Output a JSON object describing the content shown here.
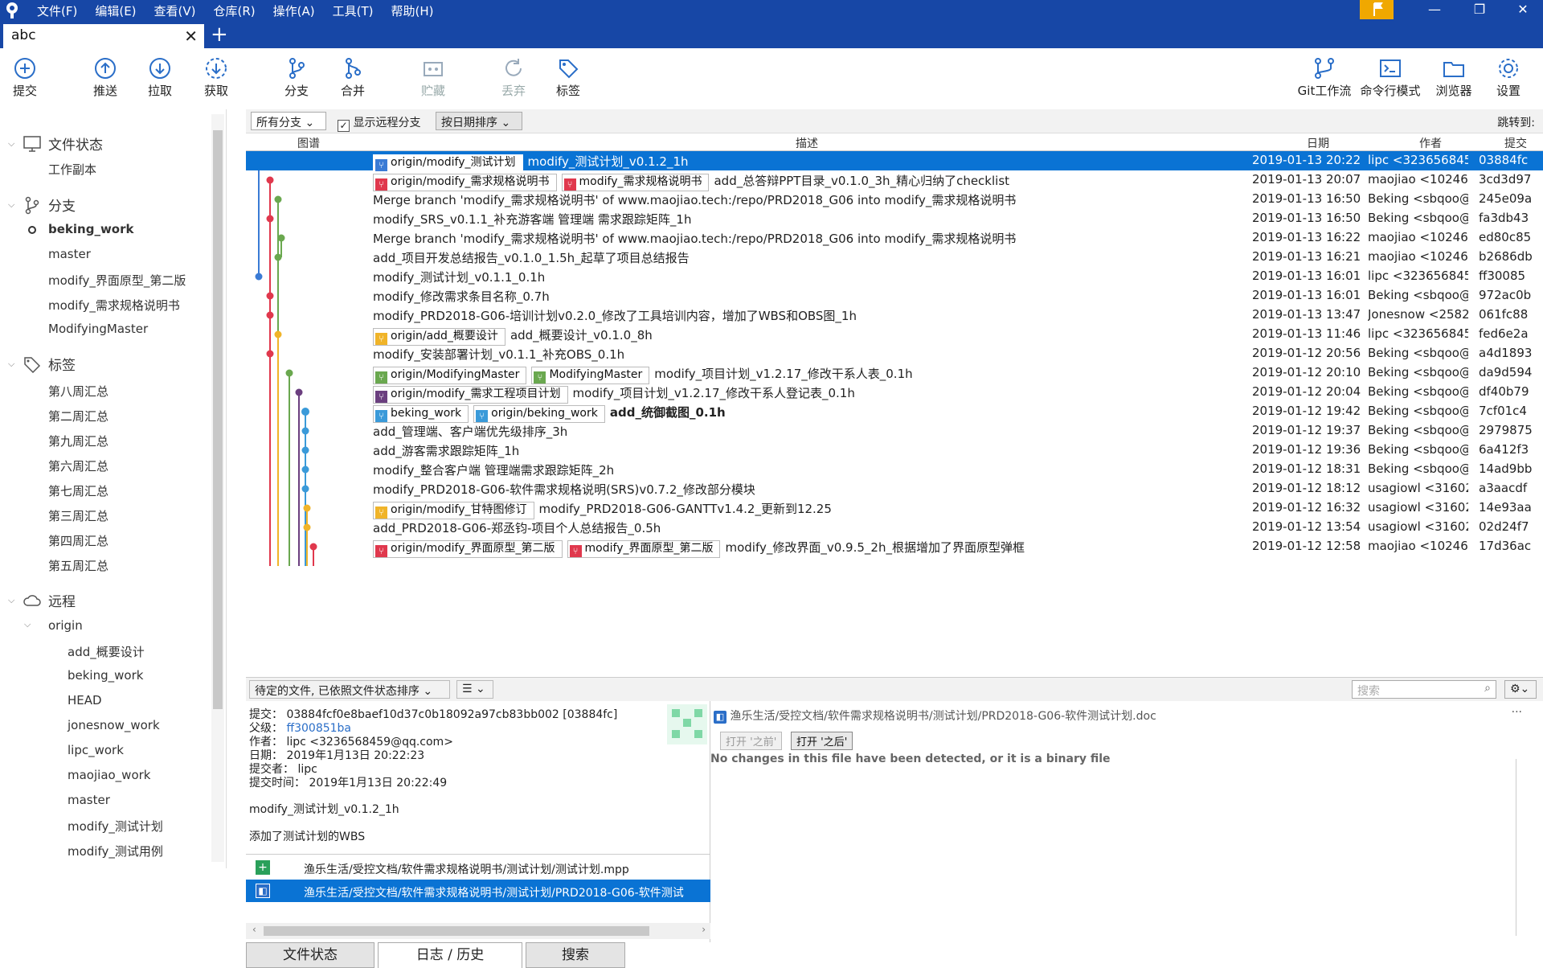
{
  "menu": [
    "文件(F)",
    "编辑(E)",
    "查看(V)",
    "仓库(R)",
    "操作(A)",
    "工具(T)",
    "帮助(H)"
  ],
  "window": {
    "minimize": "—",
    "restore": "❐",
    "close": "✕"
  },
  "tab": {
    "title": "abc",
    "close": "✕",
    "new": "+"
  },
  "toolbar": {
    "commit": "提交",
    "push": "推送",
    "pull": "拉取",
    "fetch": "获取",
    "branch": "分支",
    "merge": "合并",
    "stash": "贮藏",
    "discard": "丢弃",
    "tag": "标签",
    "gitflow": "Git工作流",
    "terminal": "命令行模式",
    "explorer": "浏览器",
    "settings": "设置"
  },
  "sidebar": {
    "file_status": "文件状态",
    "working_copy": "工作副本",
    "branches": "分支",
    "branch_items": [
      "beking_work",
      "master",
      "modify_界面原型_第二版",
      "modify_需求规格说明书",
      "ModifyingMaster"
    ],
    "tags": "标签",
    "tag_items": [
      "第八周汇总",
      "第二周汇总",
      "第九周汇总",
      "第六周汇总",
      "第七周汇总",
      "第三周汇总",
      "第四周汇总",
      "第五周汇总"
    ],
    "remotes": "远程",
    "remote_name": "origin",
    "remote_items": [
      "add_概要设计",
      "beking_work",
      "HEAD",
      "jonesnow_work",
      "lipc_work",
      "maojiao_work",
      "master",
      "modify_测试计划",
      "modify_测试用例"
    ]
  },
  "filter": {
    "branches": "所有分支",
    "show_remote": "显示远程分支",
    "sort": "按日期排序",
    "jump": "跳转到:"
  },
  "columns": {
    "graph": "图谱",
    "desc": "描述",
    "date": "日期",
    "author": "作者",
    "commit": "提交"
  },
  "commits": [
    {
      "badges": [
        {
          "t": "origin/modify_测试计划",
          "c": "#3a7bd5"
        }
      ],
      "msg": "modify_测试计划_v0.1.2_1h",
      "date": "2019-01-13 20:22",
      "author": "lipc <3236568459@qq.com>",
      "hash": "03884fc"
    },
    {
      "badges": [
        {
          "t": "origin/modify_需求规格说明书",
          "c": "#e0384d"
        },
        {
          "t": "modify_需求规格说明书",
          "c": "#e0384d"
        }
      ],
      "msg": "add_总答辩PPT目录_v0.1.0_3h_精心归纳了checklist",
      "date": "2019-01-13 20:07",
      "author": "maojiao <10246",
      "hash": "3cd3d97"
    },
    {
      "badges": [],
      "msg": "Merge branch 'modify_需求规格说明书' of www.maojiao.tech:/repo/PRD2018_G06 into modify_需求规格说明书",
      "date": "2019-01-13 16:50",
      "author": "Beking <sbqoo@",
      "hash": "245e09a"
    },
    {
      "badges": [],
      "msg": "modify_SRS_v0.1.1_补充游客端 管理端 需求跟踪矩阵_1h",
      "date": "2019-01-13 16:50",
      "author": "Beking <sbqoo@",
      "hash": "fa3db43"
    },
    {
      "badges": [],
      "msg": "Merge branch 'modify_需求规格说明书' of www.maojiao.tech:/repo/PRD2018_G06 into modify_需求规格说明书",
      "date": "2019-01-13 16:22",
      "author": "maojiao <10246",
      "hash": "ed80c85"
    },
    {
      "badges": [],
      "msg": "add_项目开发总结报告_v0.1.0_1.5h_起草了项目总结报告",
      "date": "2019-01-13 16:21",
      "author": "maojiao <10246",
      "hash": "b2686db"
    },
    {
      "badges": [],
      "msg": "modify_测试计划_v0.1.1_0.1h",
      "date": "2019-01-13 16:01",
      "author": "lipc <3236568459",
      "hash": "ff30085"
    },
    {
      "badges": [],
      "msg": "modify_修改需求条目名称_0.7h",
      "date": "2019-01-13 16:01",
      "author": "Beking <sbqoo@",
      "hash": "972ac0b"
    },
    {
      "badges": [],
      "msg": "modify_PRD2018-G06-培训计划v0.2.0_修改了工具培训内容，增加了WBS和OBS图_1h",
      "date": "2019-01-13 13:47",
      "author": "Jonesnow <2582",
      "hash": "061fc88"
    },
    {
      "badges": [
        {
          "t": "origin/add_概要设计",
          "c": "#f0b429"
        }
      ],
      "msg": "add_概要设计_v0.1.0_8h",
      "date": "2019-01-13 11:46",
      "author": "lipc <3236568459",
      "hash": "fed6e2a"
    },
    {
      "badges": [],
      "msg": "modify_安装部署计划_v0.1.1_补充OBS_0.1h",
      "date": "2019-01-12 20:56",
      "author": "Beking <sbqoo@",
      "hash": "a4d1893"
    },
    {
      "badges": [
        {
          "t": "origin/ModifyingMaster",
          "c": "#6aa84f"
        },
        {
          "t": "ModifyingMaster",
          "c": "#6aa84f"
        }
      ],
      "msg": "modify_项目计划_v1.2.17_修改干系人表_0.1h",
      "date": "2019-01-12 20:10",
      "author": "Beking <sbqoo@",
      "hash": "da9d594"
    },
    {
      "badges": [
        {
          "t": "origin/modify_需求工程项目计划",
          "c": "#6b3f7f"
        }
      ],
      "msg": "modify_项目计划_v1.2.17_修改干系人登记表_0.1h",
      "date": "2019-01-12 20:04",
      "author": "Beking <sbqoo@",
      "hash": "df40b79"
    },
    {
      "badges": [
        {
          "t": "beking_work",
          "c": "#3a9ad9"
        },
        {
          "t": "origin/beking_work",
          "c": "#3a9ad9"
        }
      ],
      "msg": "add_统御截图_0.1h",
      "date": "2019-01-12 19:42",
      "author": "Beking <sbqoo@",
      "hash": "7cf01c4",
      "bold": true
    },
    {
      "badges": [],
      "msg": "add_管理端、客户端优先级排序_3h",
      "date": "2019-01-12 19:37",
      "author": "Beking <sbqoo@",
      "hash": "2979875"
    },
    {
      "badges": [],
      "msg": "add_游客需求跟踪矩阵_1h",
      "date": "2019-01-12 19:36",
      "author": "Beking <sbqoo@",
      "hash": "6a412f3"
    },
    {
      "badges": [],
      "msg": "modify_整合客户端 管理端需求跟踪矩阵_2h",
      "date": "2019-01-12 18:31",
      "author": "Beking <sbqoo@",
      "hash": "14ad9bb"
    },
    {
      "badges": [],
      "msg": "modify_PRD2018-G06-软件需求规格说明(SRS)v0.7.2_修改部分模块",
      "date": "2019-01-12 18:12",
      "author": "usagiowl <31602",
      "hash": "a3aacdf"
    },
    {
      "badges": [
        {
          "t": "origin/modify_甘特图修订",
          "c": "#f0b429"
        }
      ],
      "msg": "modify_PRD2018-G06-GANTTv1.4.2_更新到12.25",
      "date": "2019-01-12 16:32",
      "author": "usagiowl <31602",
      "hash": "14e93aa"
    },
    {
      "badges": [],
      "msg": "add_PRD2018-G06-郑丞钧-项目个人总结报告_0.5h",
      "date": "2019-01-12 13:54",
      "author": "usagiowl <31602",
      "hash": "02d24f7"
    },
    {
      "badges": [
        {
          "t": "origin/modify_界面原型_第二版",
          "c": "#e0384d"
        },
        {
          "t": "modify_界面原型_第二版",
          "c": "#e0384d"
        }
      ],
      "msg": "modify_修改界面_v0.9.5_2h_根据增加了界面原型弹框",
      "date": "2019-01-12 12:58",
      "author": "maojiao <10246",
      "hash": "17d36ac"
    }
  ],
  "pending": {
    "label": "待定的文件, 已依照文件状态排序",
    "search": "搜索"
  },
  "detail": {
    "commit_label": "提交：",
    "commit_value": "03884fcf0e8baef10d37c0b18092a97cb83bb002 [03884fc]",
    "parent_label": "父级：",
    "parent_value": "ff300851ba",
    "author_label": "作者：",
    "author_value": "lipc <3236568459@qq.com>",
    "date_label": "日期：",
    "date_value": "2019年1月13日 20:22:23",
    "committer_label": "提交者：",
    "committer_value": "lipc",
    "committime_label": "提交时间：",
    "committime_value": "2019年1月13日 20:22:49",
    "subject": "modify_测试计划_v0.1.2_1h",
    "body": "添加了测试计划的WBS",
    "files": [
      "渔乐生活/受控文档/软件需求规格说明书/测试计划/测试计划.mpp",
      "渔乐生活/受控文档/软件需求规格说明书/测试计划/PRD2018-G06-软件测试"
    ]
  },
  "diff": {
    "path": "渔乐生活/受控文档/软件需求规格说明书/测试计划/PRD2018-G06-软件测试计划.doc",
    "open_before": "打开 '之前'",
    "open_after": "打开 '之后'",
    "message": "No changes in this file have been detected, or it is a binary file",
    "more": "···"
  },
  "bottom_tabs": [
    "文件状态",
    "日志 / 历史",
    "搜索"
  ]
}
